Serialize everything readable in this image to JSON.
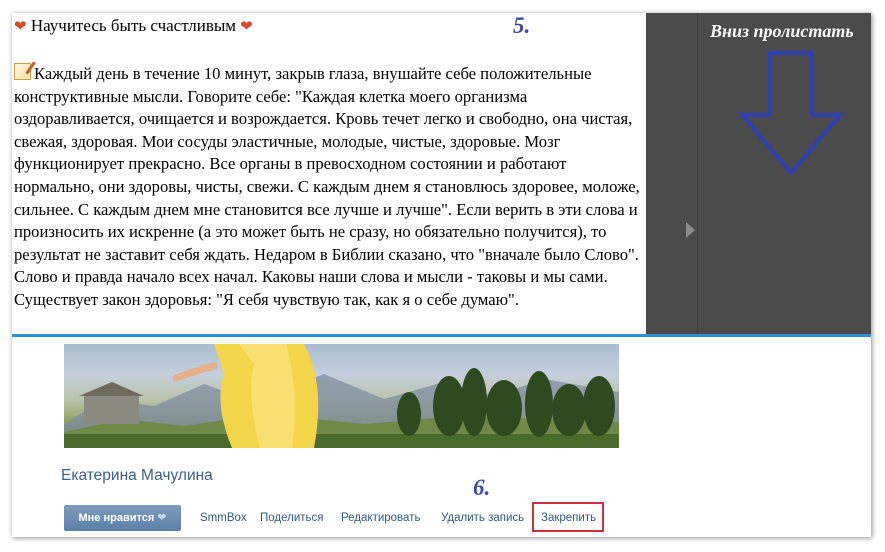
{
  "post": {
    "title": "Научитесь быть счастливым",
    "paragraph": "Каждый день в течение 10 минут, закрыв глаза, внушайте себе положительные конструктивные мысли. Говорите себе: \"Каждая клетка моего организма оздоравливается, очищается и возрождается. Кровь течет легко и свободно, она чистая, свежая, здоровая. Мои сосуды эластичные, молодые, чистые, здоровые. Мозг функционирует прекрасно. Все органы в превосходном состоянии и работают нормально, они здоровы, чисты, свежи. С каждым днем я становлюсь здоровее, моложе, сильнее. С каждым днем мне становится все лучше и лучше\". Если верить в эти слова и произносить их искренне (а это может быть не сразу, но обязательно получится), то результат не заставит себя ждать. Недаром в Библии сказано, что \"вначале было Слово\". Слово и правда начало всех начал. Каковы наши слова и мысли - таковы и мы сами. Существует закон здоровья: \"Я себя чувствую так, как я о себе думаю\"."
  },
  "annotations": {
    "step5": "5.",
    "step6": "6.",
    "scroll_hint": "Вниз пролистать"
  },
  "author": {
    "name": "Екатерина Мачулина"
  },
  "actions": {
    "like": "Мне нравится",
    "smmbox": "SmmBox",
    "share": "Поделиться",
    "edit": "Редактировать",
    "delete": "Удалить запись",
    "pin": "Закрепить"
  },
  "colors": {
    "link": "#2f5a87",
    "accent_rule": "#2f92cf",
    "annotation": "#3b4aa0",
    "highlight": "#c8323a"
  }
}
